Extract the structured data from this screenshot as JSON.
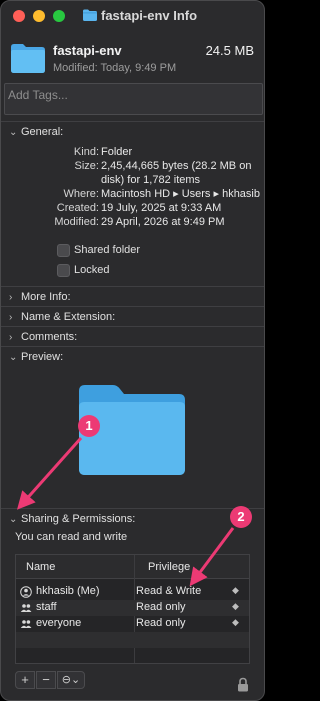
{
  "window": {
    "title": "fastapi-env Info"
  },
  "header": {
    "name": "fastapi-env",
    "size": "24.5 MB",
    "modified": "Modified: Today, 9:49 PM"
  },
  "tags": {
    "placeholder": "Add Tags..."
  },
  "general": {
    "label": "General:",
    "rows": [
      {
        "key": "Kind:",
        "value": "Folder"
      },
      {
        "key": "Size:",
        "value": "2,45,44,665 bytes (28.2 MB on disk) for 1,782 items"
      },
      {
        "key": "Where:",
        "value": "Macintosh HD ▸ Users ▸ hkhasib"
      },
      {
        "key": "Created:",
        "value": "19 July, 2025 at 9:33 AM"
      },
      {
        "key": "Modified:",
        "value": "29 April, 2026 at 9:49 PM"
      }
    ],
    "shared_folder": "Shared folder",
    "locked": "Locked"
  },
  "sections": {
    "more_info": "More Info:",
    "name_extension": "Name & Extension:",
    "comments": "Comments:",
    "preview": "Preview:",
    "sharing": "Sharing & Permissions:"
  },
  "permissions": {
    "summary": "You can read and write",
    "col_name": "Name",
    "col_privilege": "Privilege",
    "rows": [
      {
        "name": "hkhasib (Me)",
        "privilege": "Read & Write",
        "icon": "single-user-icon"
      },
      {
        "name": "staff",
        "privilege": "Read only",
        "icon": "group-icon"
      },
      {
        "name": "everyone",
        "privilege": "Read only",
        "icon": "group-icon"
      }
    ]
  },
  "toolbar": {
    "add": "+",
    "remove": "−",
    "action": "⊖",
    "action_chevron": "⌄"
  },
  "callouts": {
    "one": "1",
    "two": "2"
  },
  "colors": {
    "accent": "#ec3a74",
    "folder": "#5ab5ee"
  }
}
